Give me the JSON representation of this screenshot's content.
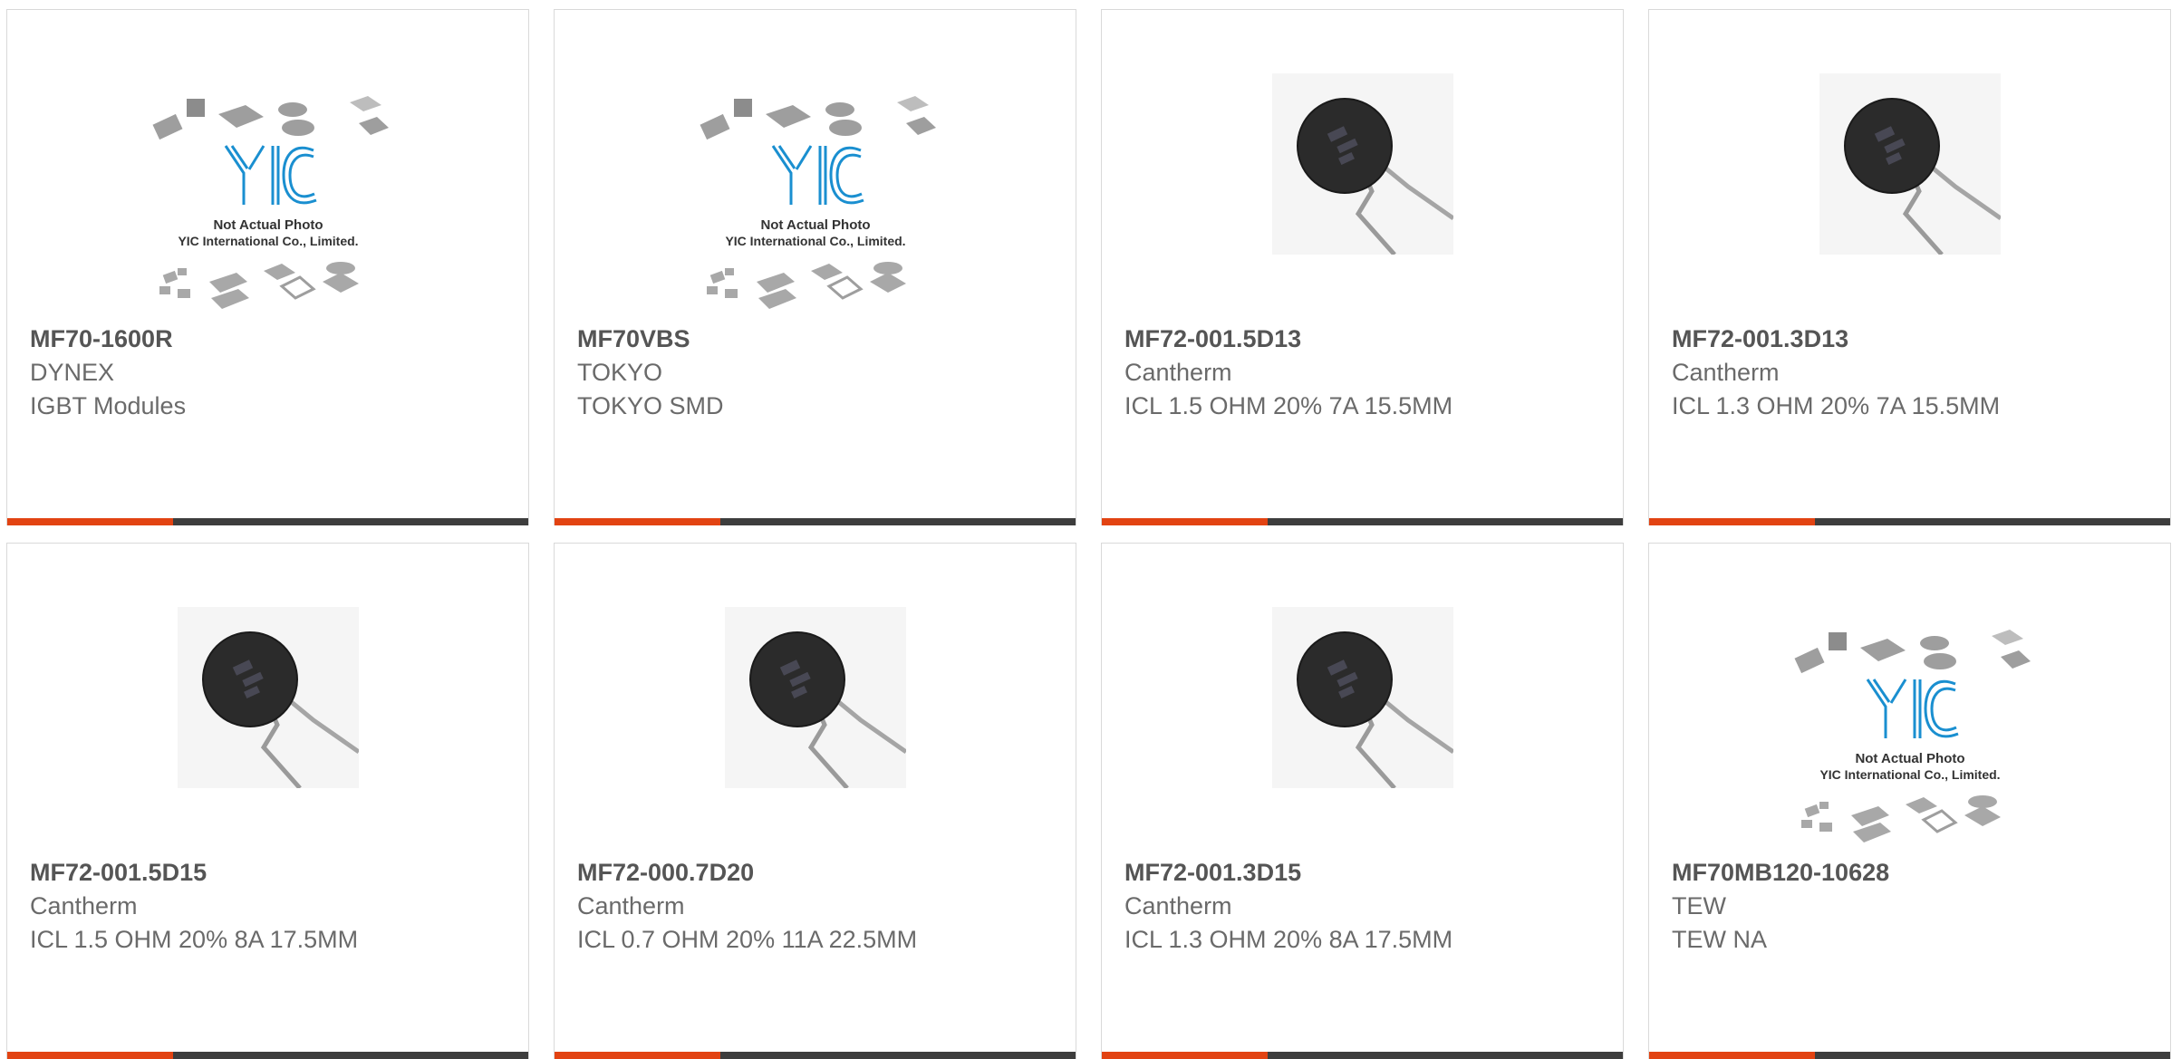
{
  "colors": {
    "accent": "#e24312",
    "bar": "#3d3d3d",
    "logo_blue": "#1a8fd0"
  },
  "placeholder": {
    "line1": "Not Actual Photo",
    "line2": "YIC International Co., Limited.",
    "logo_text": "YIC"
  },
  "products": [
    {
      "part": "MF70-1600R",
      "maker": "DYNEX",
      "desc": "IGBT Modules",
      "image": "placeholder-image"
    },
    {
      "part": "MF70VBS",
      "maker": "TOKYO",
      "desc": "TOKYO SMD",
      "image": "placeholder-image"
    },
    {
      "part": "MF72-001.5D13",
      "maker": "Cantherm",
      "desc": "ICL 1.5 OHM 20% 7A 15.5MM",
      "image": "thermistor-photo"
    },
    {
      "part": "MF72-001.3D13",
      "maker": "Cantherm",
      "desc": "ICL 1.3 OHM 20% 7A 15.5MM",
      "image": "thermistor-photo"
    },
    {
      "part": "MF72-001.5D15",
      "maker": "Cantherm",
      "desc": "ICL 1.5 OHM 20% 8A 17.5MM",
      "image": "thermistor-photo"
    },
    {
      "part": "MF72-000.7D20",
      "maker": "Cantherm",
      "desc": "ICL 0.7 OHM 20% 11A 22.5MM",
      "image": "thermistor-photo"
    },
    {
      "part": "MF72-001.3D15",
      "maker": "Cantherm",
      "desc": "ICL 1.3 OHM 20% 8A 17.5MM",
      "image": "thermistor-photo"
    },
    {
      "part": "MF70MB120-10628",
      "maker": "TEW",
      "desc": "TEW NA",
      "image": "placeholder-image"
    }
  ]
}
